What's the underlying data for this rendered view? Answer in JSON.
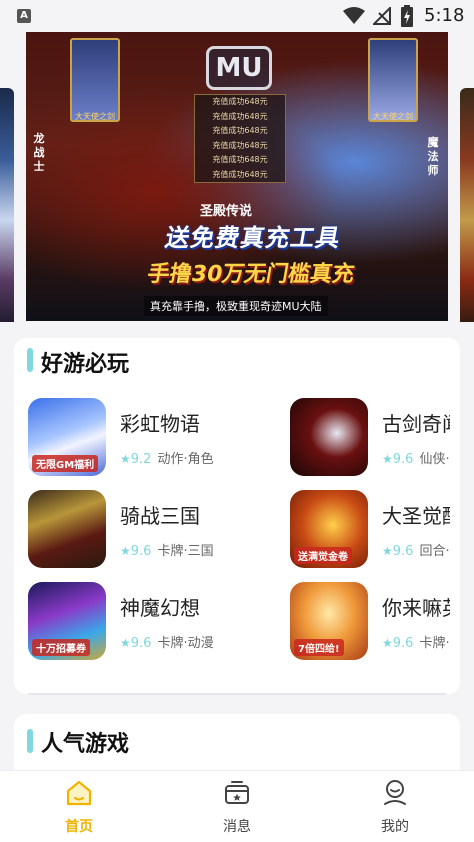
{
  "status_bar": {
    "sim_label": "A",
    "time": "5:18"
  },
  "banner": {
    "logo": "MU",
    "left_card_caption": "大天使之剑",
    "right_card_caption": "大天使之剑",
    "recharge_log": [
      "充值成功648元",
      "充值成功648元",
      "充值成功648元",
      "充值成功648元",
      "充值成功648元",
      "充值成功648元"
    ],
    "left_tag": "龙战士",
    "right_tag": "魔法师",
    "sub_title": "圣殿传说",
    "slogan_1": "送免费真充工具",
    "slogan_2": "手撸30万无门槛真充",
    "footer": "真充靠手撸，极致重现奇迹MU大陆"
  },
  "sections": [
    {
      "title": "好游必玩",
      "games": [
        {
          "name": "彩虹物语",
          "rating": "9.2",
          "tags": "动作·角色",
          "thumb_tag": "无限GM福利"
        },
        {
          "name": "古剑奇闻录",
          "rating": "9.6",
          "tags": "仙侠·角色",
          "thumb_tag": ""
        },
        {
          "name": "骑战三国",
          "rating": "9.6",
          "tags": "卡牌·三国",
          "thumb_tag": ""
        },
        {
          "name": "大圣觉醒",
          "rating": "9.6",
          "tags": "回合·西游",
          "thumb_tag": "送满觉金卷"
        },
        {
          "name": "神魔幻想",
          "rating": "9.6",
          "tags": "卡牌·动漫",
          "thumb_tag": "十万招募券"
        },
        {
          "name": "你来嘛英雄",
          "rating": "9.6",
          "tags": "卡牌·动漫",
          "thumb_tag": "7倍四给!"
        }
      ]
    },
    {
      "title": "人气游戏"
    }
  ],
  "tabs": [
    {
      "label": "首页",
      "icon": "home-icon",
      "active": true
    },
    {
      "label": "消息",
      "icon": "message-box-icon",
      "active": false
    },
    {
      "label": "我的",
      "icon": "profile-icon",
      "active": false
    }
  ],
  "colors": {
    "accent_teal": "#7ed8dd",
    "active_tab": "#f0b400",
    "background": "#f4f4f6"
  }
}
